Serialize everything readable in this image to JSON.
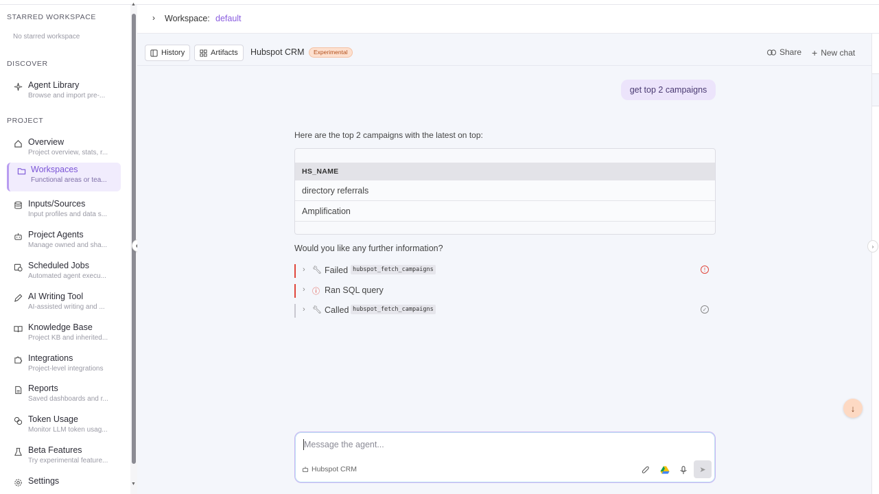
{
  "sidebar": {
    "starred_title": "STARRED WORKSPACE",
    "starred_empty": "No starred workspace",
    "discover_title": "DISCOVER",
    "discover_items": [
      {
        "label": "Agent Library",
        "sub": "Browse and import pre-...",
        "icon": "sparkle-icon"
      }
    ],
    "project_title": "PROJECT",
    "project_items": [
      {
        "label": "Overview",
        "sub": "Project overview, stats, r...",
        "icon": "home-icon"
      },
      {
        "label": "Workspaces",
        "sub": "Functional areas or tea...",
        "icon": "folder-icon",
        "active": true
      },
      {
        "label": "Inputs/Sources",
        "sub": "Input profiles and data s...",
        "icon": "database-icon"
      },
      {
        "label": "Project Agents",
        "sub": "Manage owned and sha...",
        "icon": "robot-icon"
      },
      {
        "label": "Scheduled Jobs",
        "sub": "Automated agent execu...",
        "icon": "calendar-clock-icon"
      },
      {
        "label": "AI Writing Tool",
        "sub": "AI-assisted writing and ...",
        "icon": "pen-icon"
      },
      {
        "label": "Knowledge Base",
        "sub": "Project KB and inherited...",
        "icon": "book-icon"
      },
      {
        "label": "Integrations",
        "sub": "Project-level integrations",
        "icon": "puzzle-icon"
      },
      {
        "label": "Reports",
        "sub": "Saved dashboards and r...",
        "icon": "report-icon"
      },
      {
        "label": "Token Usage",
        "sub": "Monitor LLM token usag...",
        "icon": "coins-icon"
      },
      {
        "label": "Beta Features",
        "sub": "Try experimental feature...",
        "icon": "flask-icon"
      },
      {
        "label": "Settings",
        "sub": "",
        "icon": "gear-icon"
      }
    ]
  },
  "workspace_bar": {
    "label": "Workspace:",
    "value": "default"
  },
  "chat_header": {
    "history": "History",
    "artifacts": "Artifacts",
    "title": "Hubspot CRM",
    "badge": "Experimental",
    "share": "Share",
    "new_chat": "New chat"
  },
  "messages": {
    "user": "get top 2 campaigns",
    "intro": "Here are the top 2 campaigns with the latest on top:",
    "table": {
      "header": "HS_NAME",
      "rows": [
        "directory referrals",
        "Amplification"
      ]
    },
    "followup": "Would you like any further information?",
    "tools": [
      {
        "label": "Failed",
        "code": "hubspot_fetch_campaigns",
        "status": "error"
      },
      {
        "label": "Ran SQL query",
        "code": "",
        "status": "error"
      },
      {
        "label": "Called",
        "code": "hubspot_fetch_campaigns",
        "status": "ok"
      }
    ]
  },
  "composer": {
    "placeholder": "Message the agent...",
    "agent": "Hubspot CRM"
  },
  "colors": {
    "accent": "#8a5de0",
    "error": "#e0453a",
    "badge_bg": "#fde0cf"
  }
}
